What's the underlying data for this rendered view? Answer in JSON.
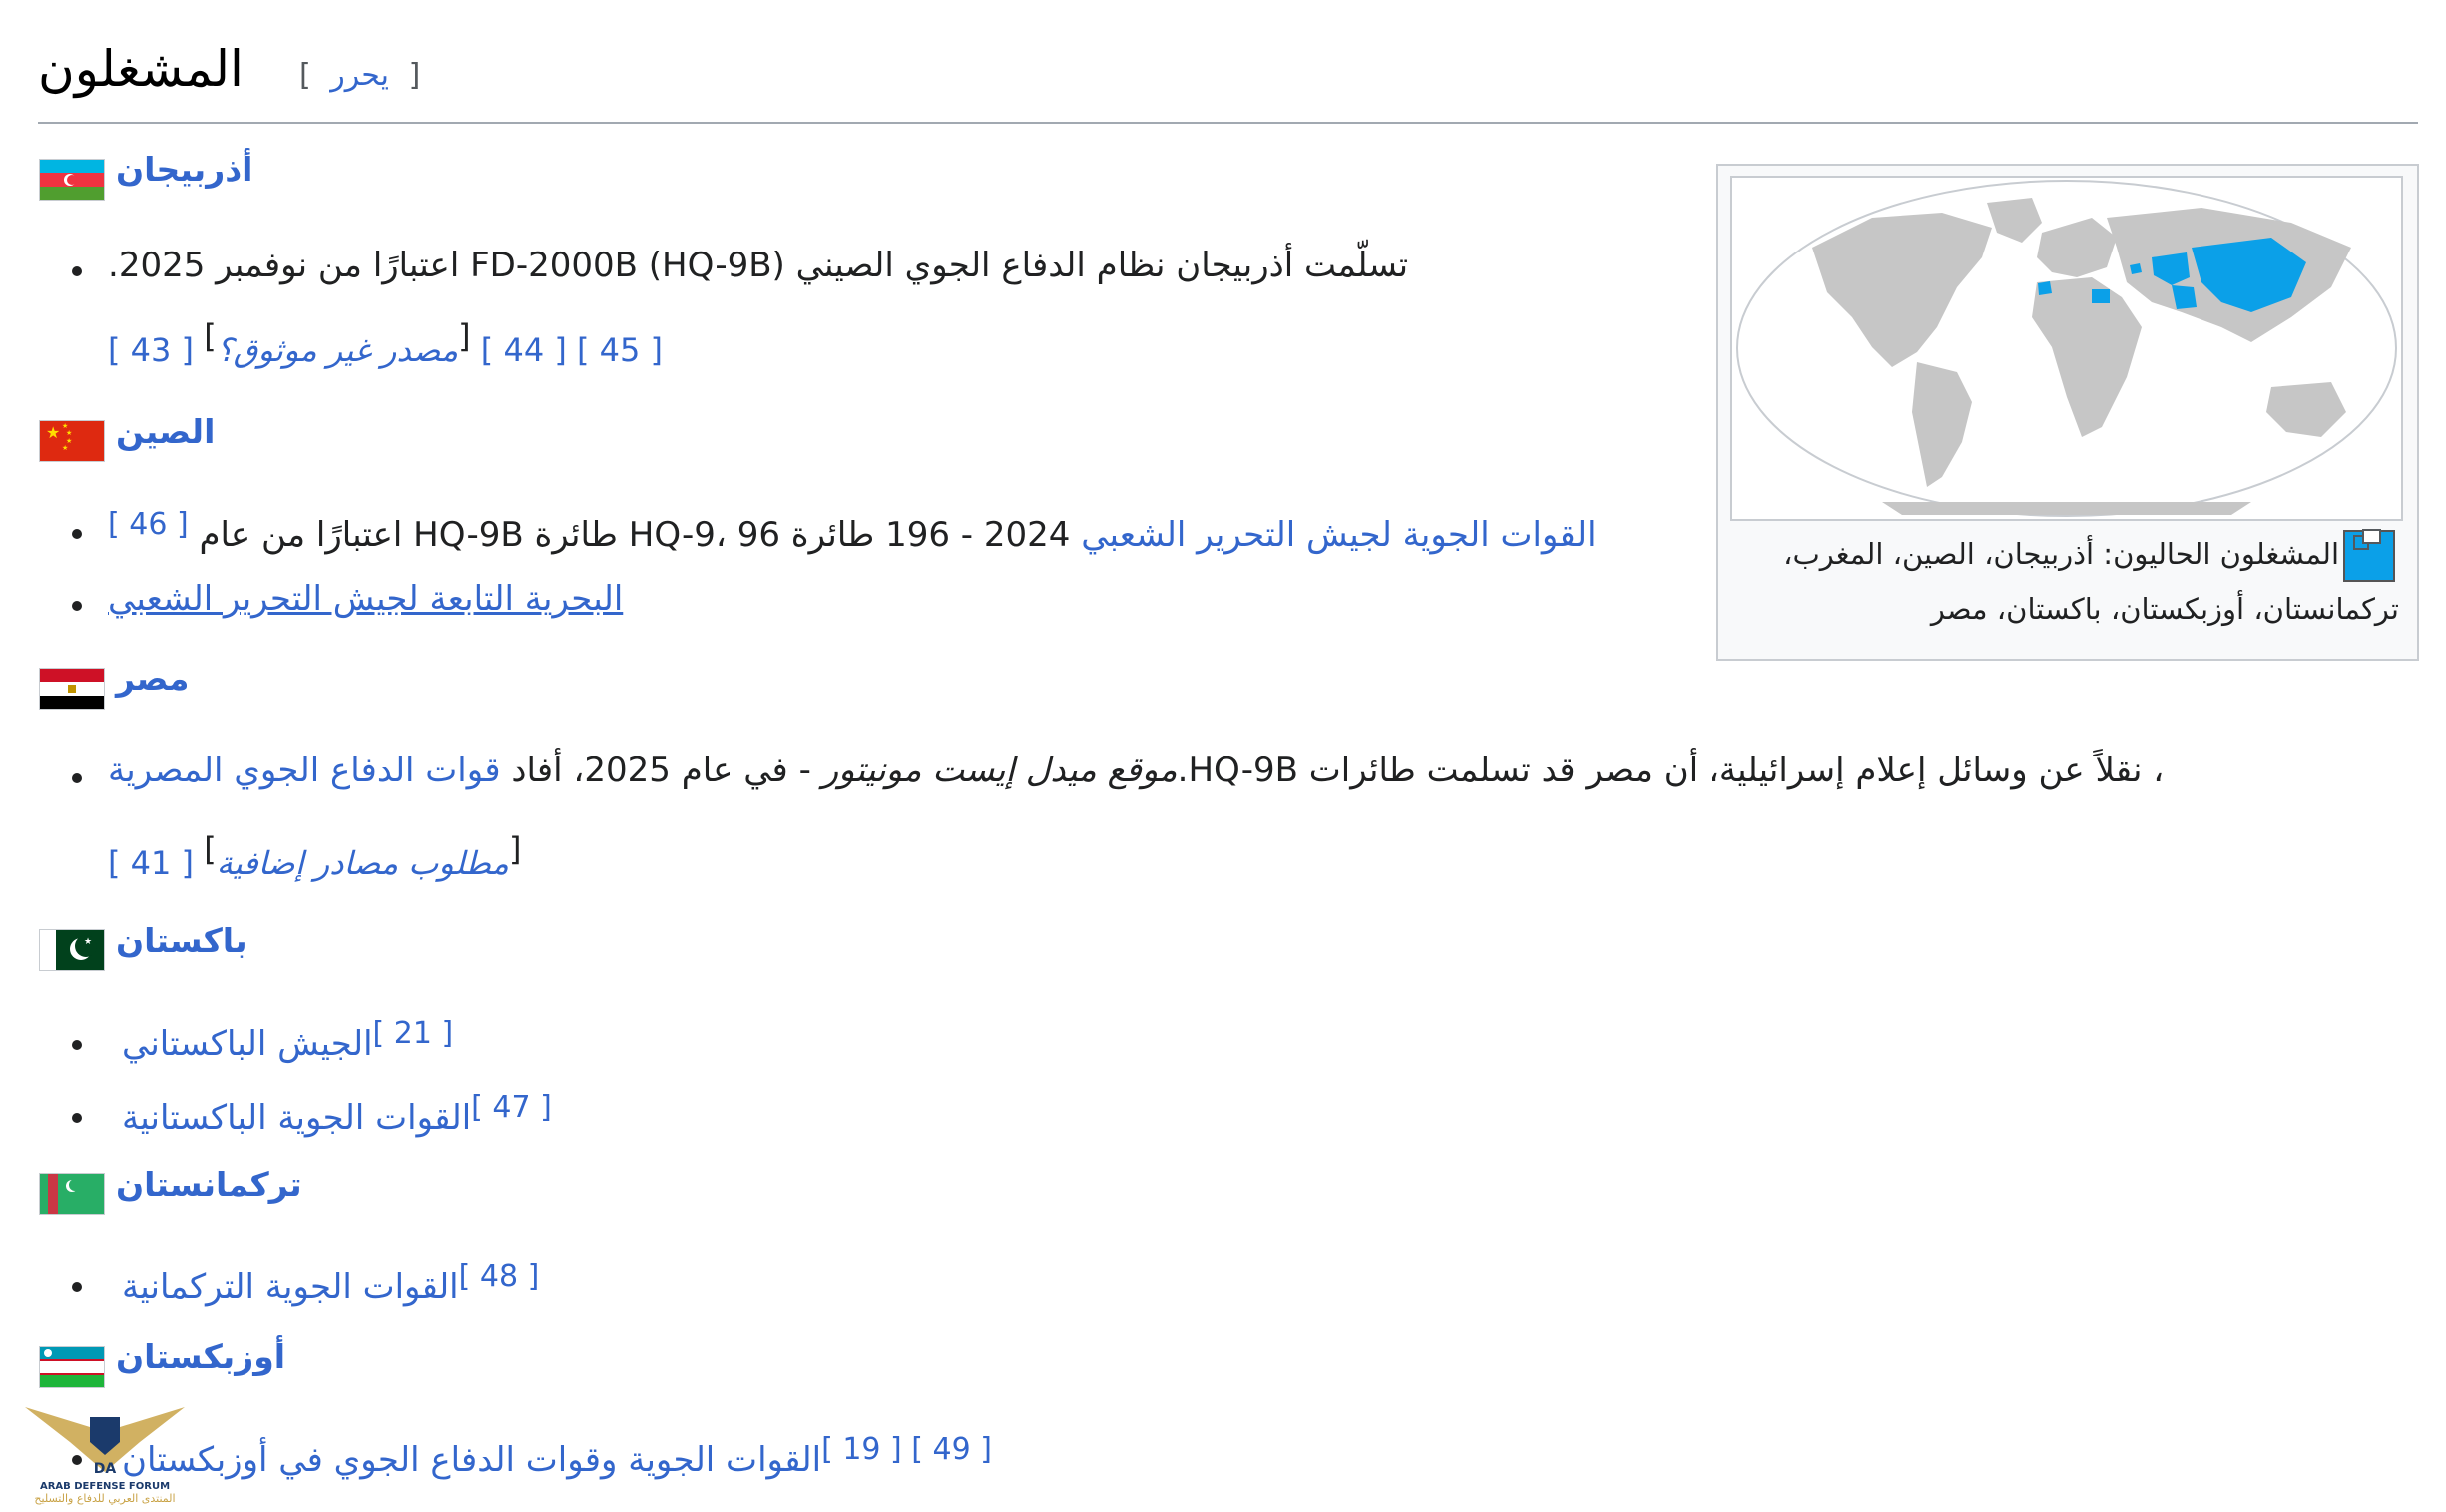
{
  "section": {
    "title": "المشغلون",
    "edit_open": "[",
    "edit_label": "يحرر",
    "edit_close": "]"
  },
  "infobox": {
    "caption": "المشغلون الحاليون: أذربيجان، الصين، المغرب، تركمانستان، أوزبكستان، باكستان، مصر",
    "legend_color": "#0ba0e8"
  },
  "countries": [
    {
      "name": "أذربيجان",
      "items": [
        {
          "text": "تسلّمت أذربيجان نظام الدفاع الجوي الصيني (FD-2000B (HQ-9B اعتبارًا من نوفمبر 2025."
        }
      ],
      "refs": [
        "[ 43 ]",
        "مصدر غير موثوق؟",
        "[ 44 ]",
        "[ 45 ]"
      ]
    },
    {
      "name": "الصين",
      "items": [
        {
          "link": "القوات الجوية لجيش التحرير الشعبي",
          "text": "2024 - 196 طائرة HQ-9، 96 طائرة HQ-9B اعتبارًا من عام",
          "ref": "[ 46 ]"
        },
        {
          "link": "البحرية التابعة لجيش التحرير الشعبي"
        }
      ]
    },
    {
      "name": "مصر",
      "items": [
        {
          "text_a": "، نقلاً عن وسائل إعلام إسرائيلية، أن مصر قد تسلمت طائرات HQ-9B.",
          "italic": "موقع ميدل إيست مونيتور",
          "text_b": " - في عام 2025، أفاد ",
          "link": "قوات الدفاع الجوي المصرية"
        }
      ],
      "refs": [
        "[ 41 ]",
        "مطلوب مصادر إضافية"
      ]
    },
    {
      "name": "باكستان",
      "items": [
        {
          "link": "الجيش الباكستاني",
          "ref": "[ 21 ]"
        },
        {
          "link": "القوات الجوية الباكستانية",
          "ref": "[ 47 ]"
        }
      ]
    },
    {
      "name": "تركمانستان",
      "items": [
        {
          "link": "القوات الجوية التركمانية",
          "ref": "[ 48 ]"
        }
      ]
    },
    {
      "name": "أوزبكستان",
      "items": [
        {
          "link": "القوات الجوية وقوات الدفاع الجوي في أوزبكستان",
          "ref": "[ 19 ] [ 49 ]"
        }
      ]
    }
  ],
  "colors": {
    "link": "#3366cc",
    "text": "#202122",
    "rule": "#a2a9b1"
  },
  "watermark": {
    "line1": "ARAB DEFENSE FORUM",
    "line2": "المنتدى العربي للدفاع والتسليح"
  }
}
